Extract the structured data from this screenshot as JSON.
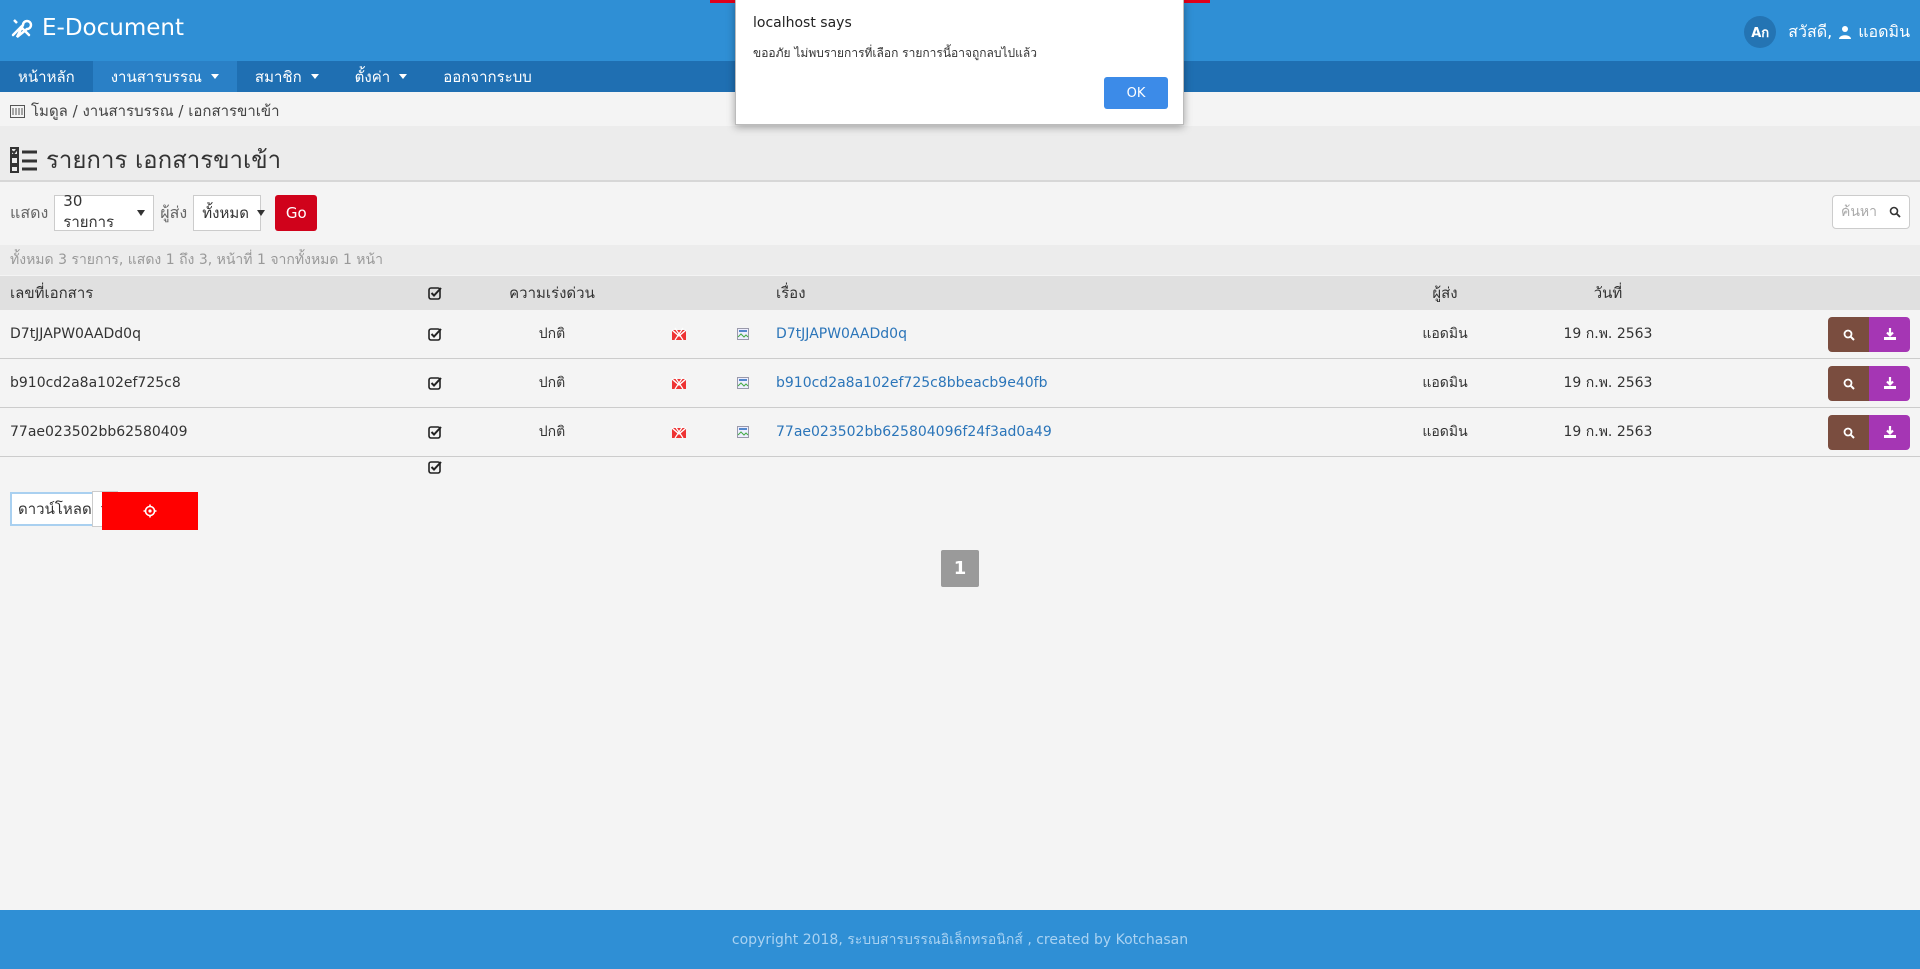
{
  "app": {
    "title": "E-Document"
  },
  "header": {
    "lang_label": "Aก",
    "greeting": "สวัสดี,",
    "user_name": "แอดมิน"
  },
  "nav": {
    "items": [
      {
        "label": "หน้าหลัก"
      },
      {
        "label": "งานสารบรรณ"
      },
      {
        "label": "สมาชิก"
      },
      {
        "label": "ตั้งค่า"
      },
      {
        "label": "ออกจากระบบ"
      }
    ]
  },
  "breadcrumb": {
    "text": "โมดูล / งานสารบรรณ / เอกสารขาเข้า"
  },
  "page": {
    "title": "รายการ เอกสารขาเข้า"
  },
  "filters": {
    "show_label": "แสดง",
    "show_value": "30 รายการ",
    "sender_label": "ผู้ส่ง",
    "sender_value": "ทั้งหมด",
    "go_label": "Go",
    "search_placeholder": "ค้นหา"
  },
  "summary": "ทั้งหมด 3 รายการ, แสดง 1 ถึง 3, หน้าที่ 1 จากทั้งหมด 1 หน้า",
  "table": {
    "headers": {
      "doc_no": "เลขที่เอกสาร",
      "urgency": "ความเร่งด่วน",
      "subject": "เรื่อง",
      "sender": "ผู้ส่ง",
      "date": "วันที่"
    },
    "rows": [
      {
        "doc_no": "D7tJJAPW0AADd0q",
        "urgency": "ปกติ",
        "subject": "D7tJJAPW0AADd0q",
        "sender": "แอดมิน",
        "date": "19 ก.พ. 2563"
      },
      {
        "doc_no": "b910cd2a8a102ef725c8",
        "urgency": "ปกติ",
        "subject": "b910cd2a8a102ef725c8bbeacb9e40fb",
        "sender": "แอดมิน",
        "date": "19 ก.พ. 2563"
      },
      {
        "doc_no": "77ae023502bb62580409",
        "urgency": "ปกติ",
        "subject": "77ae023502bb625804096f24f3ad0a49",
        "sender": "แอดมิน",
        "date": "19 ก.พ. 2563"
      }
    ]
  },
  "bulk": {
    "action_value": "ดาวน์โหลด"
  },
  "pagination": {
    "current": "1"
  },
  "footer": {
    "text": "copyright 2018, ระบบสารบรรณอิเล็กทรอนิกส์ , created by Kotchasan"
  },
  "dialog": {
    "title": "localhost says",
    "message": "ขออภัย ไม่พบรายการที่เลือก รายการนี้อาจถูกลบไปแล้ว",
    "ok_label": "OK"
  },
  "colors": {
    "header": "#2f8fd5",
    "nav": "#1f6fb2",
    "go": "#d0021b",
    "view": "#7a4d3f",
    "download": "#a536b4",
    "ok": "#3c8be8"
  }
}
